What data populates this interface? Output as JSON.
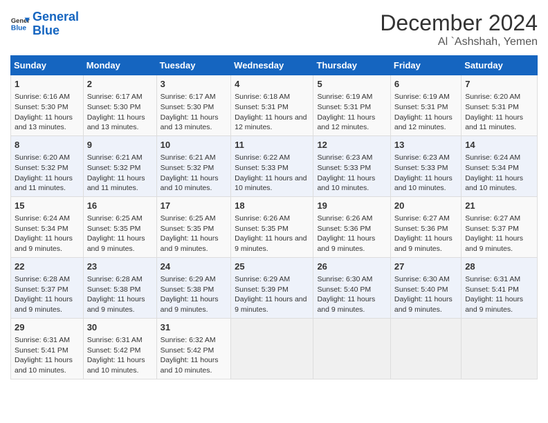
{
  "logo": {
    "line1": "General",
    "line2": "Blue"
  },
  "title": "December 2024",
  "subtitle": "Al `Ashshah, Yemen",
  "days_header": [
    "Sunday",
    "Monday",
    "Tuesday",
    "Wednesday",
    "Thursday",
    "Friday",
    "Saturday"
  ],
  "weeks": [
    [
      {
        "day": "1",
        "sunrise": "Sunrise: 6:16 AM",
        "sunset": "Sunset: 5:30 PM",
        "daylight": "Daylight: 11 hours and 13 minutes."
      },
      {
        "day": "2",
        "sunrise": "Sunrise: 6:17 AM",
        "sunset": "Sunset: 5:30 PM",
        "daylight": "Daylight: 11 hours and 13 minutes."
      },
      {
        "day": "3",
        "sunrise": "Sunrise: 6:17 AM",
        "sunset": "Sunset: 5:30 PM",
        "daylight": "Daylight: 11 hours and 13 minutes."
      },
      {
        "day": "4",
        "sunrise": "Sunrise: 6:18 AM",
        "sunset": "Sunset: 5:31 PM",
        "daylight": "Daylight: 11 hours and 12 minutes."
      },
      {
        "day": "5",
        "sunrise": "Sunrise: 6:19 AM",
        "sunset": "Sunset: 5:31 PM",
        "daylight": "Daylight: 11 hours and 12 minutes."
      },
      {
        "day": "6",
        "sunrise": "Sunrise: 6:19 AM",
        "sunset": "Sunset: 5:31 PM",
        "daylight": "Daylight: 11 hours and 12 minutes."
      },
      {
        "day": "7",
        "sunrise": "Sunrise: 6:20 AM",
        "sunset": "Sunset: 5:31 PM",
        "daylight": "Daylight: 11 hours and 11 minutes."
      }
    ],
    [
      {
        "day": "8",
        "sunrise": "Sunrise: 6:20 AM",
        "sunset": "Sunset: 5:32 PM",
        "daylight": "Daylight: 11 hours and 11 minutes."
      },
      {
        "day": "9",
        "sunrise": "Sunrise: 6:21 AM",
        "sunset": "Sunset: 5:32 PM",
        "daylight": "Daylight: 11 hours and 11 minutes."
      },
      {
        "day": "10",
        "sunrise": "Sunrise: 6:21 AM",
        "sunset": "Sunset: 5:32 PM",
        "daylight": "Daylight: 11 hours and 10 minutes."
      },
      {
        "day": "11",
        "sunrise": "Sunrise: 6:22 AM",
        "sunset": "Sunset: 5:33 PM",
        "daylight": "Daylight: 11 hours and 10 minutes."
      },
      {
        "day": "12",
        "sunrise": "Sunrise: 6:23 AM",
        "sunset": "Sunset: 5:33 PM",
        "daylight": "Daylight: 11 hours and 10 minutes."
      },
      {
        "day": "13",
        "sunrise": "Sunrise: 6:23 AM",
        "sunset": "Sunset: 5:33 PM",
        "daylight": "Daylight: 11 hours and 10 minutes."
      },
      {
        "day": "14",
        "sunrise": "Sunrise: 6:24 AM",
        "sunset": "Sunset: 5:34 PM",
        "daylight": "Daylight: 11 hours and 10 minutes."
      }
    ],
    [
      {
        "day": "15",
        "sunrise": "Sunrise: 6:24 AM",
        "sunset": "Sunset: 5:34 PM",
        "daylight": "Daylight: 11 hours and 9 minutes."
      },
      {
        "day": "16",
        "sunrise": "Sunrise: 6:25 AM",
        "sunset": "Sunset: 5:35 PM",
        "daylight": "Daylight: 11 hours and 9 minutes."
      },
      {
        "day": "17",
        "sunrise": "Sunrise: 6:25 AM",
        "sunset": "Sunset: 5:35 PM",
        "daylight": "Daylight: 11 hours and 9 minutes."
      },
      {
        "day": "18",
        "sunrise": "Sunrise: 6:26 AM",
        "sunset": "Sunset: 5:35 PM",
        "daylight": "Daylight: 11 hours and 9 minutes."
      },
      {
        "day": "19",
        "sunrise": "Sunrise: 6:26 AM",
        "sunset": "Sunset: 5:36 PM",
        "daylight": "Daylight: 11 hours and 9 minutes."
      },
      {
        "day": "20",
        "sunrise": "Sunrise: 6:27 AM",
        "sunset": "Sunset: 5:36 PM",
        "daylight": "Daylight: 11 hours and 9 minutes."
      },
      {
        "day": "21",
        "sunrise": "Sunrise: 6:27 AM",
        "sunset": "Sunset: 5:37 PM",
        "daylight": "Daylight: 11 hours and 9 minutes."
      }
    ],
    [
      {
        "day": "22",
        "sunrise": "Sunrise: 6:28 AM",
        "sunset": "Sunset: 5:37 PM",
        "daylight": "Daylight: 11 hours and 9 minutes."
      },
      {
        "day": "23",
        "sunrise": "Sunrise: 6:28 AM",
        "sunset": "Sunset: 5:38 PM",
        "daylight": "Daylight: 11 hours and 9 minutes."
      },
      {
        "day": "24",
        "sunrise": "Sunrise: 6:29 AM",
        "sunset": "Sunset: 5:38 PM",
        "daylight": "Daylight: 11 hours and 9 minutes."
      },
      {
        "day": "25",
        "sunrise": "Sunrise: 6:29 AM",
        "sunset": "Sunset: 5:39 PM",
        "daylight": "Daylight: 11 hours and 9 minutes."
      },
      {
        "day": "26",
        "sunrise": "Sunrise: 6:30 AM",
        "sunset": "Sunset: 5:40 PM",
        "daylight": "Daylight: 11 hours and 9 minutes."
      },
      {
        "day": "27",
        "sunrise": "Sunrise: 6:30 AM",
        "sunset": "Sunset: 5:40 PM",
        "daylight": "Daylight: 11 hours and 9 minutes."
      },
      {
        "day": "28",
        "sunrise": "Sunrise: 6:31 AM",
        "sunset": "Sunset: 5:41 PM",
        "daylight": "Daylight: 11 hours and 9 minutes."
      }
    ],
    [
      {
        "day": "29",
        "sunrise": "Sunrise: 6:31 AM",
        "sunset": "Sunset: 5:41 PM",
        "daylight": "Daylight: 11 hours and 10 minutes."
      },
      {
        "day": "30",
        "sunrise": "Sunrise: 6:31 AM",
        "sunset": "Sunset: 5:42 PM",
        "daylight": "Daylight: 11 hours and 10 minutes."
      },
      {
        "day": "31",
        "sunrise": "Sunrise: 6:32 AM",
        "sunset": "Sunset: 5:42 PM",
        "daylight": "Daylight: 11 hours and 10 minutes."
      },
      null,
      null,
      null,
      null
    ]
  ]
}
